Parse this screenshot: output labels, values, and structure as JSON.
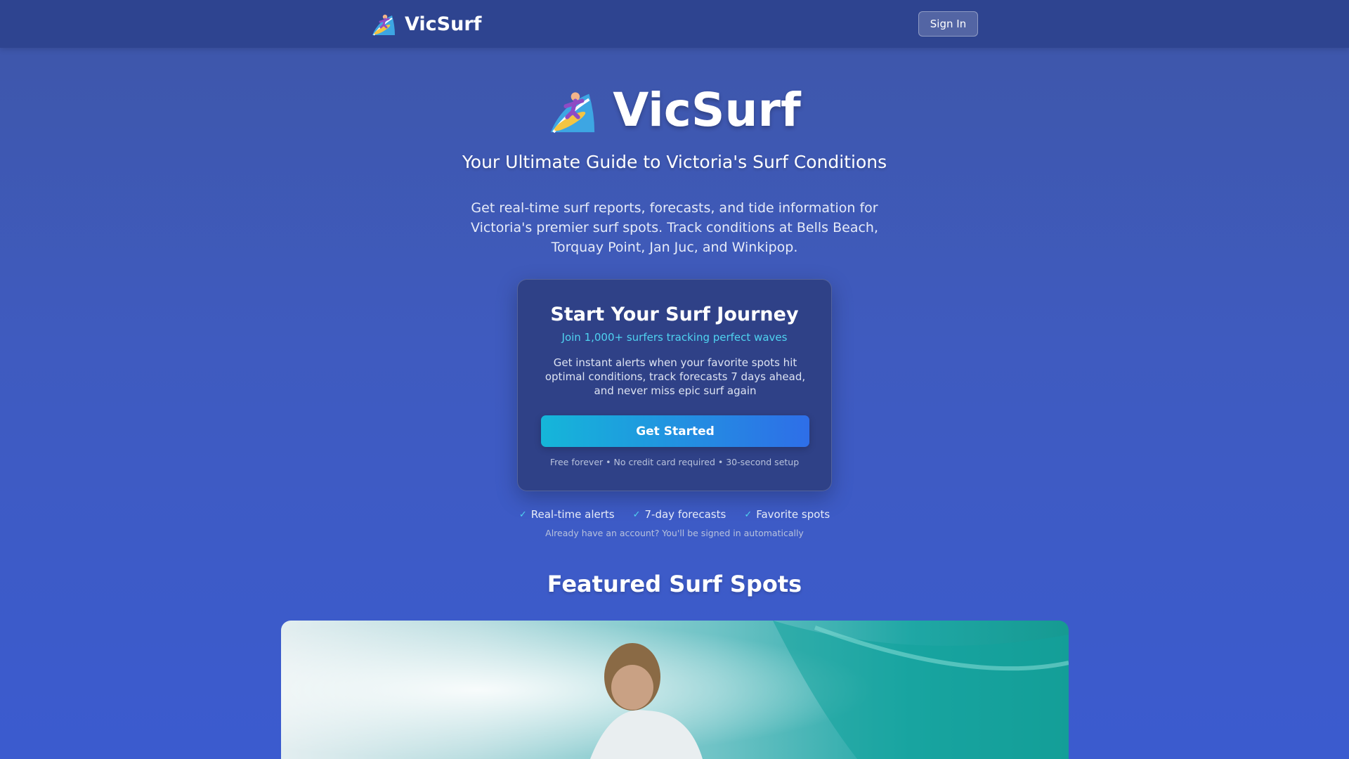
{
  "header": {
    "brand_name": "VicSurf",
    "signin_label": "Sign In",
    "icon": "surfer-icon"
  },
  "hero": {
    "title": "VicSurf",
    "subtitle": "Your Ultimate Guide to Victoria's Surf Conditions",
    "description": "Get real-time surf reports, forecasts, and tide information for Victoria's premier surf spots. Track conditions at Bells Beach, Torquay Point, Jan Juc, and Winkipop."
  },
  "card": {
    "title": "Start Your Surf Journey",
    "tagline": "Join 1,000+ surfers tracking perfect waves",
    "description": "Get instant alerts when your favorite spots hit optimal conditions, track forecasts 7 days ahead, and never miss epic surf again",
    "cta_label": "Get Started",
    "fine_print": "Free forever • No credit card required • 30-second setup"
  },
  "features": [
    {
      "check": "✓",
      "label": "Real-time alerts"
    },
    {
      "check": "✓",
      "label": "7-day forecasts"
    },
    {
      "check": "✓",
      "label": "Favorite spots"
    }
  ],
  "signed_note": "Already have an account? You'll be signed in automatically",
  "featured": {
    "title": "Featured Surf Spots"
  },
  "colors": {
    "accent": "#4fd3f0",
    "cta_start": "#15b6d9",
    "cta_end": "#2e6ee8",
    "header_bg": "#2e4490",
    "card_bg": "#2f4187"
  }
}
